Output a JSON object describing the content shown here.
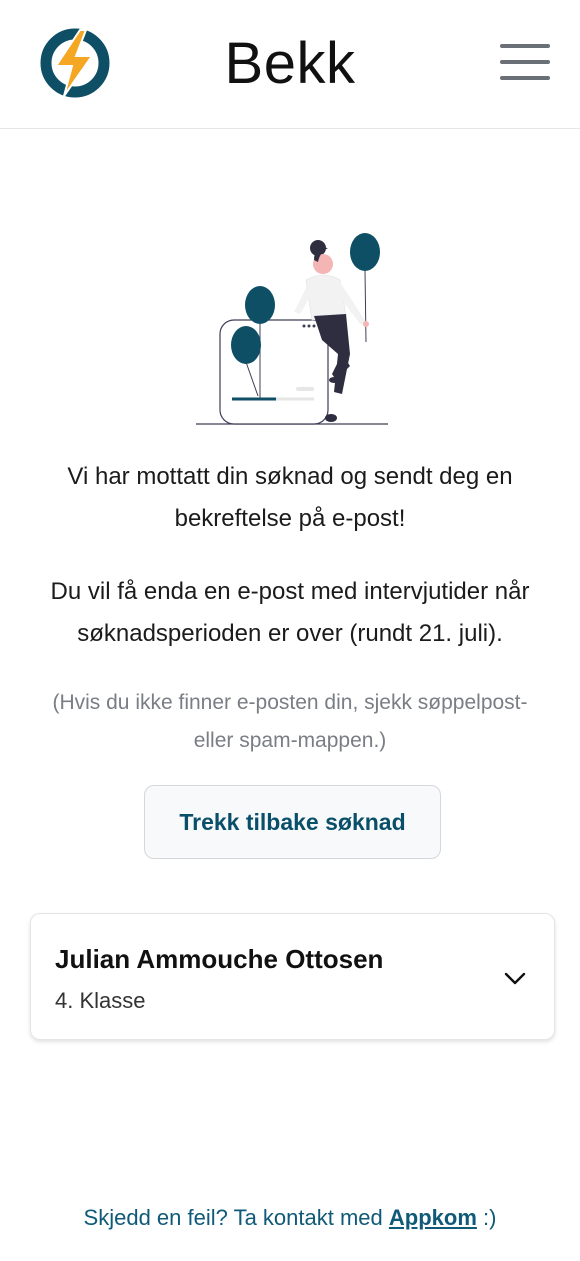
{
  "header": {
    "brand": "Bekk",
    "logo_icon": "lightning-logo-icon",
    "menu_icon": "hamburger-menu-icon"
  },
  "confirmation": {
    "illustration_icon": "woman-with-balloons-illustration",
    "message_line1": "Vi har mottatt din søknad og sendt deg en bekreftelse på e-post!",
    "message_line2": "Du vil få enda en e-post med intervjutider når søknadsperioden er over (rundt 21. juli).",
    "note": "(Hvis du ikke finner e-posten din, sjekk søppelpost- eller spam-mappen.)",
    "withdraw_button": "Trekk tilbake søknad"
  },
  "applicant": {
    "name": "Julian Ammouche Ottosen",
    "class": "4. Klasse",
    "expand_icon": "chevron-down-icon"
  },
  "footer": {
    "text": "Skjedd en feil? Ta kontakt med",
    "link": "Appkom",
    "suffix": ":)"
  },
  "colors": {
    "primary": "#0a4f6a",
    "logo_orange": "#f5a623",
    "muted": "#7a7e84"
  }
}
